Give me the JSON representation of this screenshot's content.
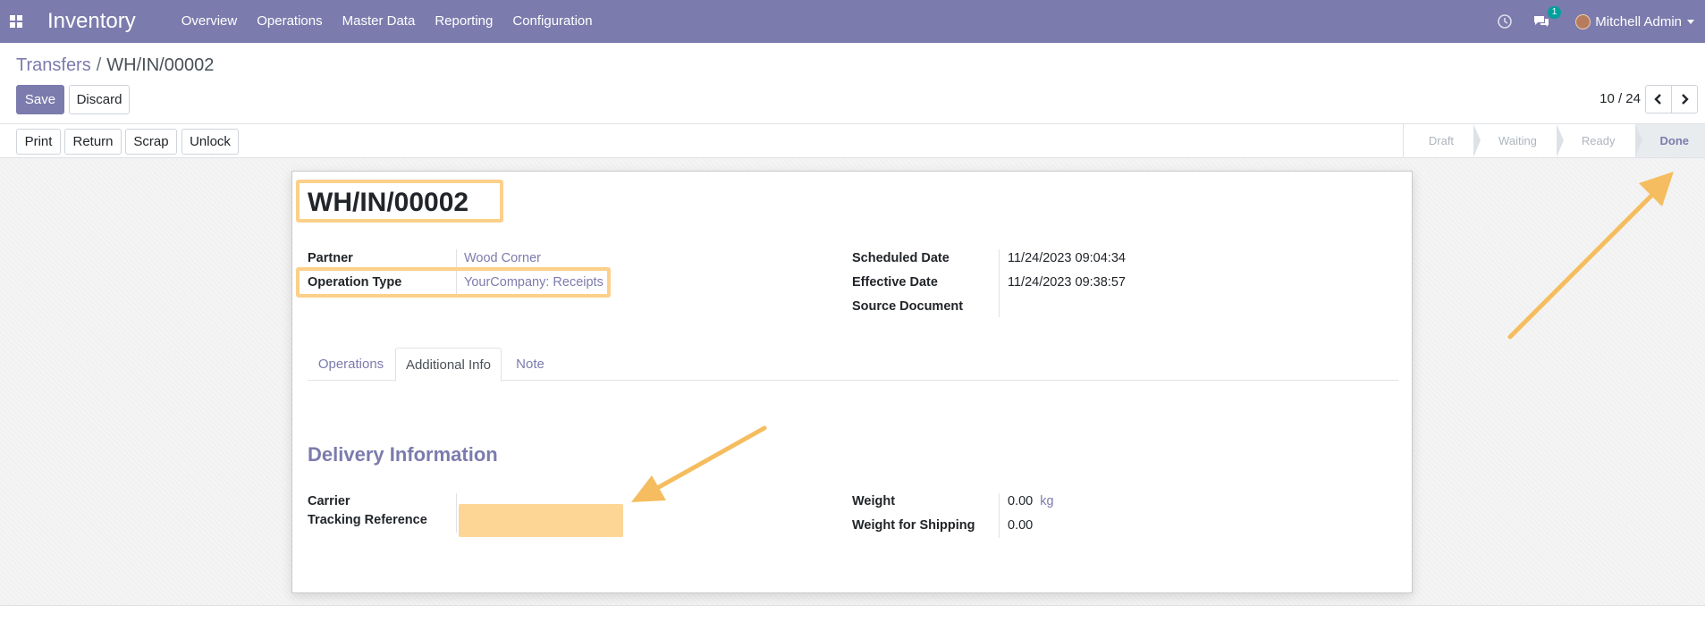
{
  "navbar": {
    "app_name": "Inventory",
    "menu": [
      "Overview",
      "Operations",
      "Master Data",
      "Reporting",
      "Configuration"
    ],
    "chat_count": "1",
    "user_name": "Mitchell Admin"
  },
  "breadcrumb": {
    "parent": "Transfers",
    "separator": "/",
    "current": "WH/IN/00002"
  },
  "actions": {
    "save": "Save",
    "discard": "Discard"
  },
  "pager": {
    "value": "10 / 24"
  },
  "statusbar": {
    "buttons": [
      "Print",
      "Return",
      "Scrap",
      "Unlock"
    ],
    "stages": [
      "Draft",
      "Waiting",
      "Ready",
      "Done"
    ],
    "current_stage": "Done"
  },
  "record": {
    "name": "WH/IN/00002",
    "partner_label": "Partner",
    "partner_value": "Wood Corner",
    "operation_type_label": "Operation Type",
    "operation_type_value": "YourCompany: Receipts",
    "scheduled_date_label": "Scheduled Date",
    "scheduled_date_value": "11/24/2023 09:04:34",
    "effective_date_label": "Effective Date",
    "effective_date_value": "11/24/2023 09:38:57",
    "source_document_label": "Source Document",
    "source_document_value": ""
  },
  "tabs": [
    "Operations",
    "Additional Info",
    "Note"
  ],
  "active_tab": "Additional Info",
  "delivery": {
    "section_title": "Delivery Information",
    "carrier_label": "Carrier",
    "tracking_label": "Tracking Reference",
    "tracking_value": "",
    "weight_label": "Weight",
    "weight_value": "0.00",
    "weight_unit": "kg",
    "shipping_weight_label": "Weight for Shipping",
    "shipping_weight_value": "0.00"
  },
  "colors": {
    "brand": "#7c7bad",
    "highlight": "#fcd08a",
    "annotation_arrow": "#f5bd5f"
  },
  "icons": [
    "apps-icon",
    "clock-icon",
    "chat-icon",
    "chevron-left-icon",
    "chevron-right-icon",
    "caret-down-icon"
  ]
}
